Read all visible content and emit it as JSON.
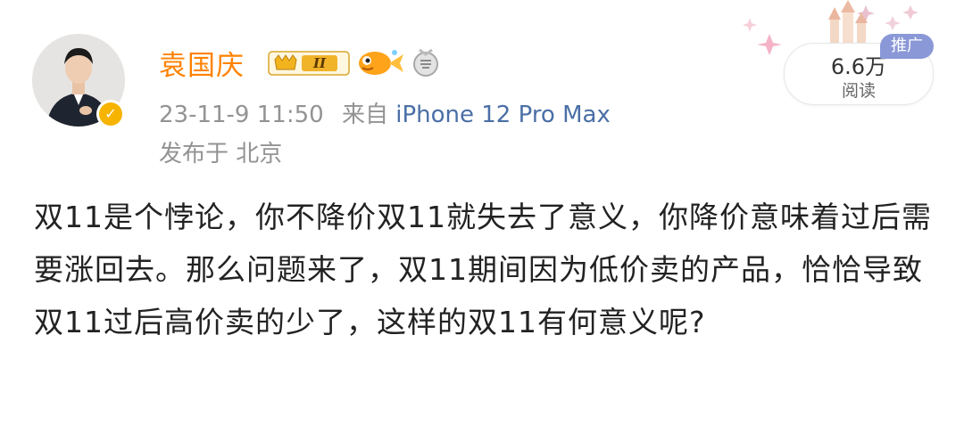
{
  "user": {
    "name": "袁国庆",
    "badge_level": "II"
  },
  "meta": {
    "timestamp": "23-11-9 11:50",
    "source_prefix": "来自",
    "device": "iPhone 12 Pro Max",
    "location": "发布于 北京"
  },
  "stats": {
    "views": "6.6万",
    "views_label": "阅读",
    "ad_tag": "推广"
  },
  "post": {
    "text": "双11是个悖论，你不降价双11就失去了意义，你降价意味着过后需要涨回去。那么问题来了，双11期间因为低价卖的产品，恰恰导致双11过后高价卖的少了，这样的双11有何意义呢?"
  },
  "colors": {
    "name": "#ff8200",
    "meta": "#939393",
    "device_link": "#4a6fa6",
    "ad_tag": "#8a98d8",
    "verify": "#f6b400"
  }
}
